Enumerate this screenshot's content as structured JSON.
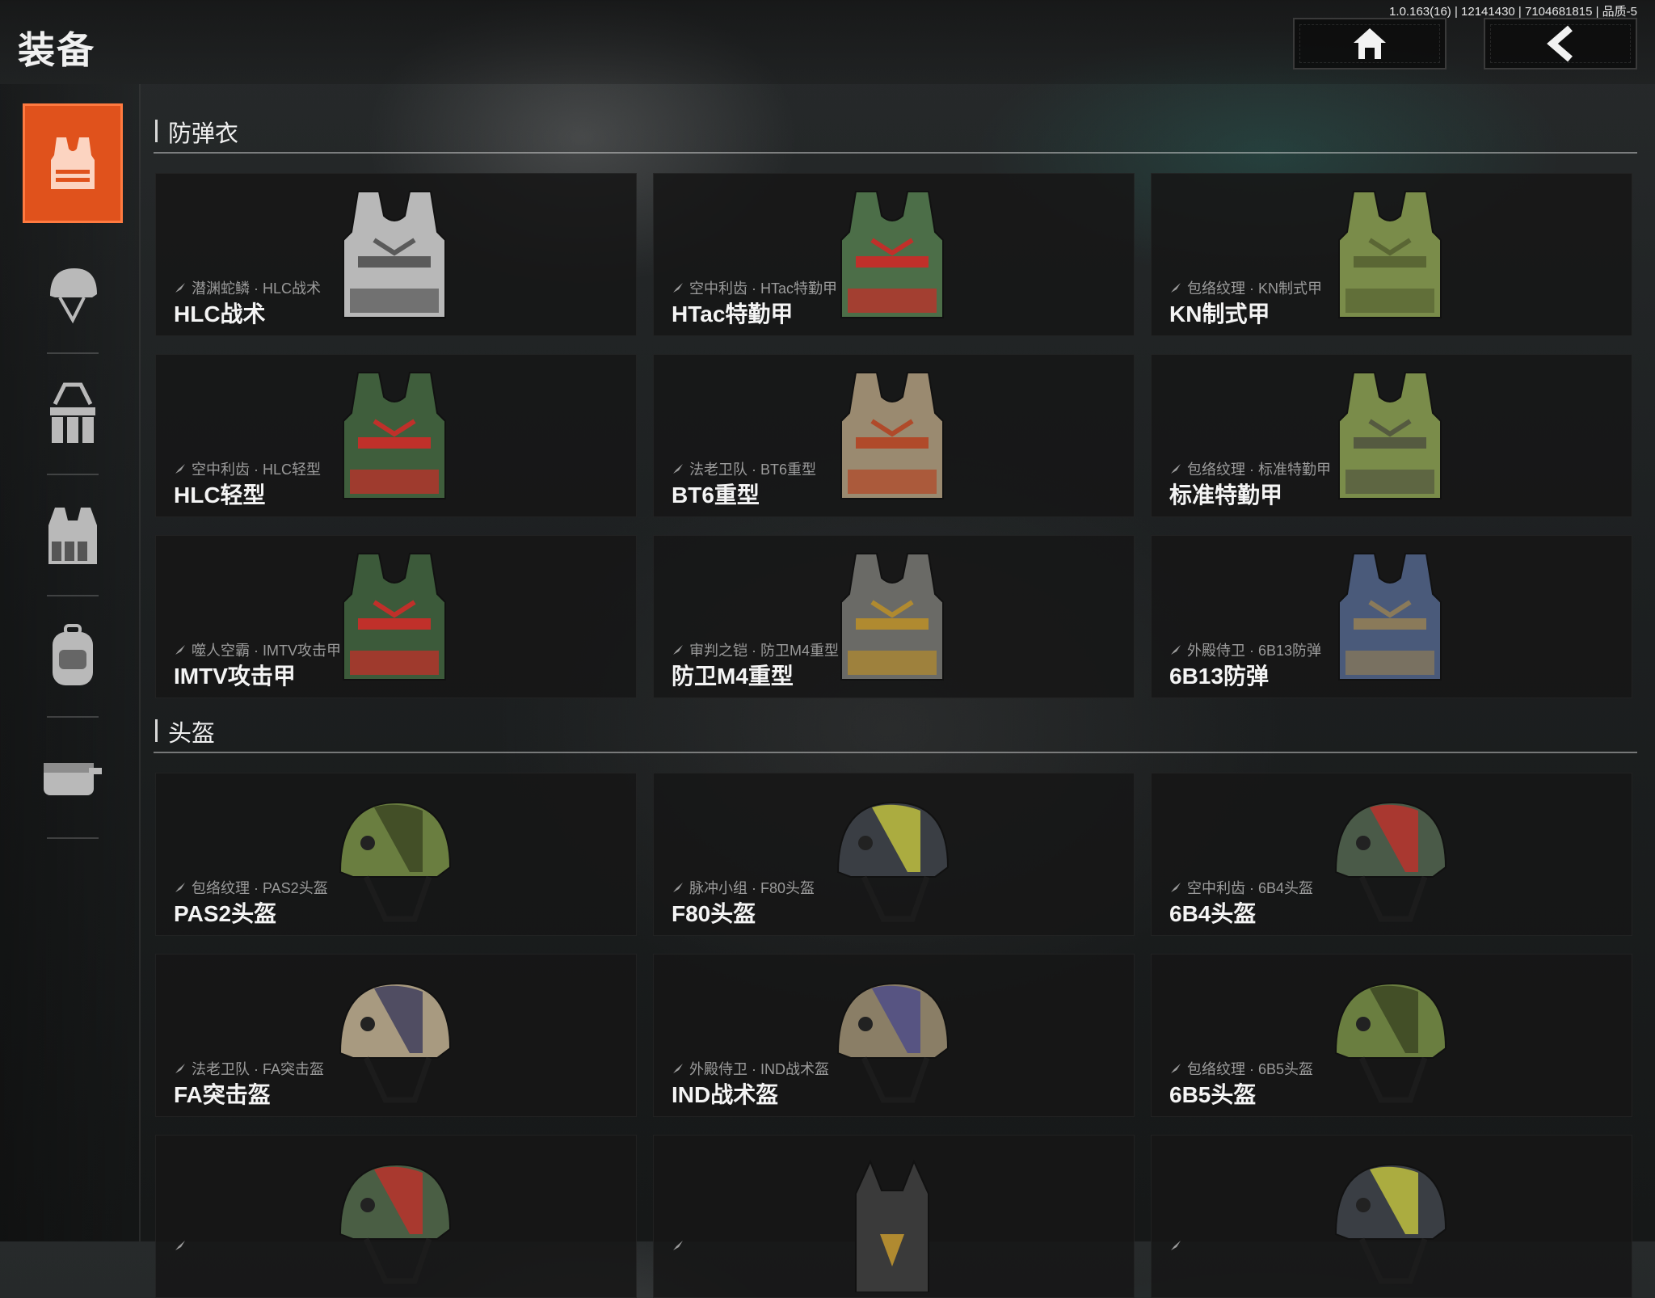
{
  "header": {
    "title": "装备",
    "version_info": "1.0.163(16) | 12141430 | 7104681815 | 品质-5",
    "home_icon": "home-icon",
    "back_icon": "chevron-left-icon"
  },
  "sidebar": {
    "items": [
      {
        "icon": "vest-icon",
        "active": true
      },
      {
        "icon": "helmet-icon",
        "active": false
      },
      {
        "icon": "chest-rig-icon",
        "active": false
      },
      {
        "icon": "tactical-vest-icon",
        "active": false
      },
      {
        "icon": "backpack-icon",
        "active": false
      },
      {
        "icon": "pouch-icon",
        "active": false
      }
    ]
  },
  "colors": {
    "accent": "#e0521c",
    "card_bg": "#161616",
    "text_secondary": "#9b9b9b"
  },
  "sections": [
    {
      "title": "防弹衣",
      "cards": [
        {
          "skin": "潜渊蛇鳞 · HLC战术",
          "name": "HLC战术",
          "icon": "vest-icon",
          "palette": [
            "#b8b8b8",
            "#5a5a5a"
          ]
        },
        {
          "skin": "空中利齿 · HTac特勤甲",
          "name": "HTac特勤甲",
          "icon": "vest-icon",
          "palette": [
            "#4c6e48",
            "#c0302a"
          ]
        },
        {
          "skin": "包络纹理 · KN制式甲",
          "name": "KN制式甲",
          "icon": "vest-icon",
          "palette": [
            "#7a8c4a",
            "#5a6634"
          ]
        },
        {
          "skin": "空中利齿 · HLC轻型",
          "name": "HLC轻型",
          "icon": "vest-icon",
          "palette": [
            "#3f5e3c",
            "#c0302a"
          ]
        },
        {
          "skin": "法老卫队 · BT6重型",
          "name": "BT6重型",
          "icon": "vest-icon",
          "palette": [
            "#9a8a70",
            "#b04a2a"
          ]
        },
        {
          "skin": "包络纹理 · 标准特勤甲",
          "name": "标准特勤甲",
          "icon": "vest-icon",
          "palette": [
            "#7a8c4a",
            "#555a40"
          ]
        },
        {
          "skin": "噬人空霸 · IMTV攻击甲",
          "name": "IMTV攻击甲",
          "icon": "vest-icon",
          "palette": [
            "#3c5a3a",
            "#c0302a"
          ]
        },
        {
          "skin": "审判之铠 · 防卫M4重型",
          "name": "防卫M4重型",
          "icon": "vest-icon",
          "palette": [
            "#6a6a66",
            "#b08a30"
          ]
        },
        {
          "skin": "外殿侍卫 · 6B13防弹",
          "name": "6B13防弹",
          "icon": "vest-icon",
          "palette": [
            "#4a5a7a",
            "#8a7a5a"
          ]
        }
      ]
    },
    {
      "title": "头盔",
      "cards": [
        {
          "skin": "包络纹理 · PAS2头盔",
          "name": "PAS2头盔",
          "icon": "helmet-icon",
          "palette": [
            "#6a7e40",
            "#3a4420"
          ]
        },
        {
          "skin": "脉冲小组 · F80头盔",
          "name": "F80头盔",
          "icon": "helmet-icon",
          "palette": [
            "#3a3e44",
            "#c8c840"
          ]
        },
        {
          "skin": "空中利齿 · 6B4头盔",
          "name": "6B4头盔",
          "icon": "helmet-icon",
          "palette": [
            "#4a5a48",
            "#c0302a"
          ]
        },
        {
          "skin": "法老卫队 · FA突击盔",
          "name": "FA突击盔",
          "icon": "helmet-icon",
          "palette": [
            "#a89a80",
            "#3a3a5a"
          ]
        },
        {
          "skin": "外殿侍卫 · IND战术盔",
          "name": "IND战术盔",
          "icon": "helmet-icon",
          "palette": [
            "#8a7e66",
            "#4a4a8a"
          ]
        },
        {
          "skin": "包络纹理 · 6B5头盔",
          "name": "6B5头盔",
          "icon": "helmet-icon",
          "palette": [
            "#6a7e40",
            "#3a4420"
          ]
        },
        {
          "skin": "",
          "name": "",
          "icon": "helmet-icon",
          "palette": [
            "#4a5e44",
            "#c0302a"
          ]
        },
        {
          "skin": "",
          "name": "",
          "icon": "cat-helmet-icon",
          "palette": [
            "#3a3a3a",
            "#b08a30"
          ]
        },
        {
          "skin": "",
          "name": "",
          "icon": "helmet-icon",
          "palette": [
            "#3a3e44",
            "#c8c840"
          ]
        }
      ]
    }
  ]
}
